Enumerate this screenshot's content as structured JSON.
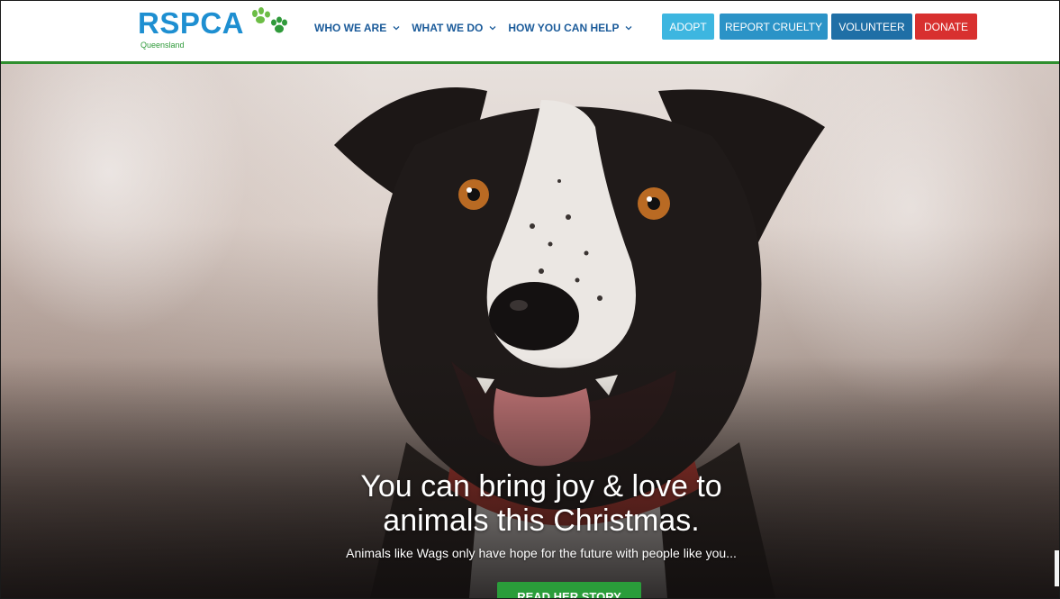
{
  "header": {
    "logo": {
      "name": "RSPCA",
      "region": "Queensland",
      "paw_icon": "paw-prints-icon"
    },
    "nav": [
      {
        "label": "WHO WE ARE"
      },
      {
        "label": "WHAT WE DO"
      },
      {
        "label": "HOW YOU CAN HELP"
      }
    ],
    "buttons": {
      "adopt": "ADOPT",
      "report": "REPORT CRUELTY",
      "volunteer": "VOLUNTEER",
      "donate": "DONATE"
    }
  },
  "hero": {
    "title_line1": "You can bring joy & love to",
    "title_line2": "animals this Christmas.",
    "subtitle": "Animals like Wags only have hope for the future with people like you...",
    "cta": "READ HER STORY"
  },
  "colors": {
    "brand_blue": "#1e8fd1",
    "brand_green": "#2f8f2f",
    "adopt": "#3db6e0",
    "report": "#2b93c7",
    "volunteer": "#1f6fa6",
    "donate": "#d8302f",
    "cta": "#2a9d3a"
  }
}
